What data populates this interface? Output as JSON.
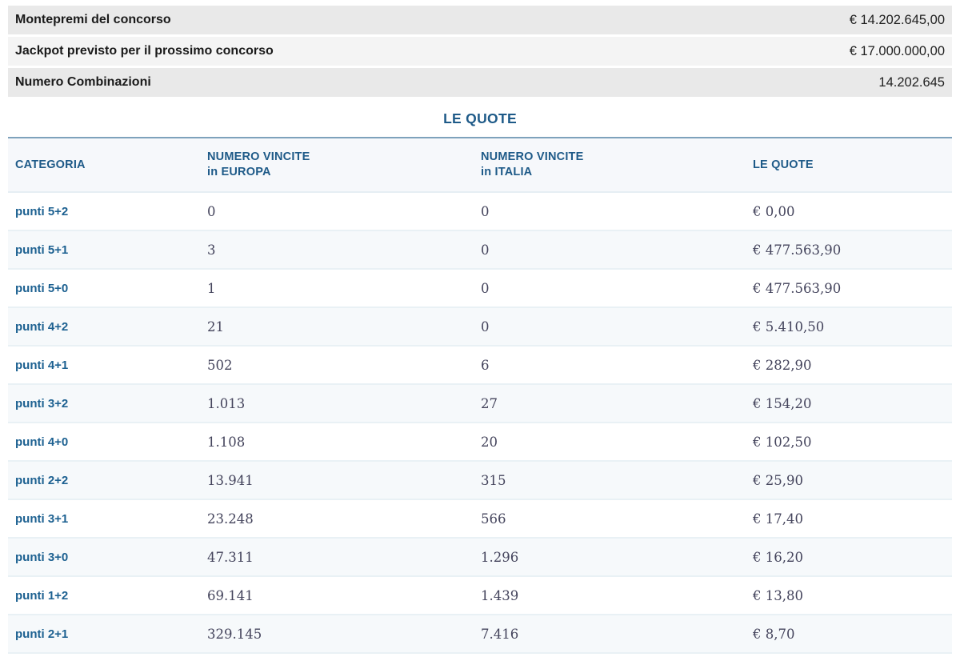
{
  "summary": {
    "rows": [
      {
        "label": "Montepremi del concorso",
        "value": "€ 14.202.645,00"
      },
      {
        "label": "Jackpot previsto per il prossimo concorso",
        "value": "€ 17.000.000,00"
      },
      {
        "label": "Numero Combinazioni",
        "value": "14.202.645"
      }
    ]
  },
  "quote_section": {
    "title": "LE QUOTE",
    "table": {
      "headers": [
        {
          "line1": "CATEGORIA",
          "line2": ""
        },
        {
          "line1": "NUMERO VINCITE",
          "line2": "in EUROPA"
        },
        {
          "line1": "NUMERO VINCITE",
          "line2": "in ITALIA"
        },
        {
          "line1": "LE QUOTE",
          "line2": ""
        }
      ],
      "rows": [
        {
          "categoria": "punti 5+2",
          "vincite_europa": "0",
          "vincite_italia": "0",
          "quota": "€ 0,00"
        },
        {
          "categoria": "punti 5+1",
          "vincite_europa": "3",
          "vincite_italia": "0",
          "quota": "€ 477.563,90"
        },
        {
          "categoria": "punti 5+0",
          "vincite_europa": "1",
          "vincite_italia": "0",
          "quota": "€ 477.563,90"
        },
        {
          "categoria": "punti 4+2",
          "vincite_europa": "21",
          "vincite_italia": "0",
          "quota": "€ 5.410,50"
        },
        {
          "categoria": "punti 4+1",
          "vincite_europa": "502",
          "vincite_italia": "6",
          "quota": "€ 282,90"
        },
        {
          "categoria": "punti 3+2",
          "vincite_europa": "1.013",
          "vincite_italia": "27",
          "quota": "€ 154,20"
        },
        {
          "categoria": "punti 4+0",
          "vincite_europa": "1.108",
          "vincite_italia": "20",
          "quota": "€ 102,50"
        },
        {
          "categoria": "punti 2+2",
          "vincite_europa": "13.941",
          "vincite_italia": "315",
          "quota": "€ 25,90"
        },
        {
          "categoria": "punti 3+1",
          "vincite_europa": "23.248",
          "vincite_italia": "566",
          "quota": "€ 17,40"
        },
        {
          "categoria": "punti 3+0",
          "vincite_europa": "47.311",
          "vincite_italia": "1.296",
          "quota": "€ 16,20"
        },
        {
          "categoria": "punti 1+2",
          "vincite_europa": "69.141",
          "vincite_italia": "1.439",
          "quota": "€ 13,80"
        },
        {
          "categoria": "punti 2+1",
          "vincite_europa": "329.145",
          "vincite_italia": "7.416",
          "quota": "€ 8,70"
        }
      ]
    }
  },
  "colors": {
    "accent_blue": "#1e5a88",
    "category_blue": "#1d6191",
    "info_row_bg_dark": "#e9e9e9",
    "info_row_bg_light": "#f4f4f4",
    "table_header_bg": "#f6f8fb",
    "row_alt_bg": "#f6f9fb",
    "table_top_border": "#7ea2bc",
    "number_text": "#44445c"
  }
}
